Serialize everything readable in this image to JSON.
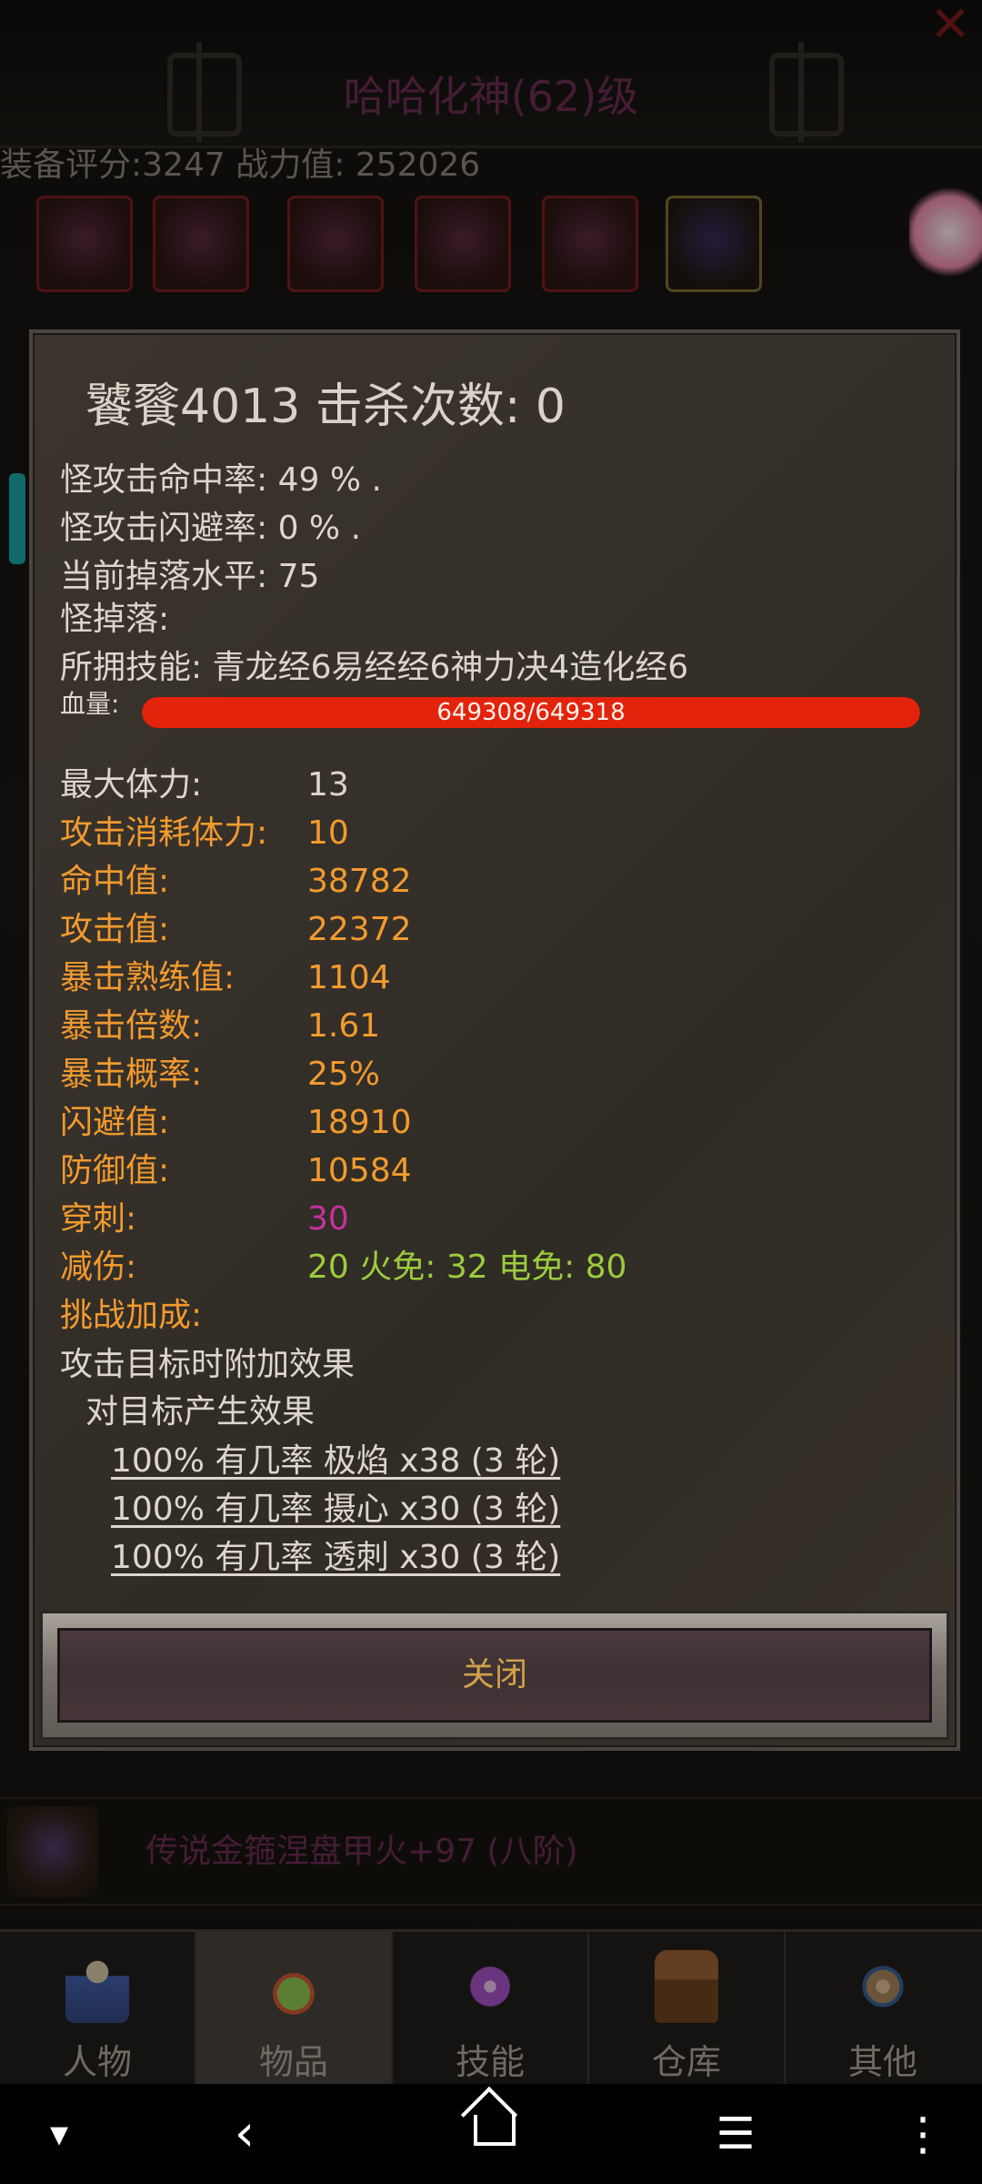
{
  "background": {
    "title": "哈哈化神(62)级",
    "stats_text": "装备评分:3247 战力值: 252026",
    "legend_item": "传说金箍涅盘甲火+97 (八阶)"
  },
  "dialog": {
    "title": "饕餮4013  击杀次数:  0",
    "lines": [
      "怪攻击命中率:  49 % .",
      "怪攻击闪避率:  0 % .",
      "当前掉落水平:  75",
      "怪掉落:",
      "所拥技能:  青龙经6易经经6神力决4造化经6"
    ],
    "hp": {
      "label": "血量:",
      "text": "649308/649318",
      "current": 649308,
      "max": 649318
    },
    "stats": [
      {
        "label": "最大体力:",
        "value": "13",
        "color": "white"
      },
      {
        "label": "攻击消耗体力:",
        "value": "10",
        "color": "orange"
      },
      {
        "label": "命中值:",
        "value": "38782",
        "color": "orange"
      },
      {
        "label": "攻击值:",
        "value": "22372",
        "color": "orange"
      },
      {
        "label": "暴击熟练值:",
        "value": "1104",
        "color": "orange"
      },
      {
        "label": "暴击倍数:",
        "value": "1.61",
        "color": "orange"
      },
      {
        "label": "暴击概率:",
        "value": "25%",
        "color": "orange"
      },
      {
        "label": "闪避值:",
        "value": "18910",
        "color": "orange"
      },
      {
        "label": "防御值:",
        "value": "10584",
        "color": "orange"
      },
      {
        "label": "穿刺:",
        "value": "30",
        "color": "orange",
        "value_color": "magenta"
      },
      {
        "label": "减伤:",
        "value": "20 火免:  32 电免:  80",
        "color": "orange",
        "value_color": "green"
      },
      {
        "label": "挑战加成:",
        "value": "",
        "color": "orange"
      }
    ],
    "effects_heading": "攻击目标时附加效果",
    "effects_subheading": "对目标产生效果",
    "effects": [
      "100% 有几率 极焰 x38 (3 轮)",
      "100% 有几率 摄心 x30 (3 轮)",
      "100% 有几率 透刺 x30 (3 轮)"
    ],
    "close_label": "关闭"
  },
  "tabs": [
    {
      "label": "人物",
      "icon": "character-icon"
    },
    {
      "label": "物品",
      "icon": "items-icon",
      "active": true
    },
    {
      "label": "技能",
      "icon": "skills-icon"
    },
    {
      "label": "仓库",
      "icon": "warehouse-icon"
    },
    {
      "label": "其他",
      "icon": "other-icon"
    }
  ],
  "colors": {
    "white": "#dcd6cc",
    "orange": "#f29a2e",
    "magenta": "#c8329c",
    "green": "#9ccc3d",
    "hp_fill": "#e3230c",
    "close_text": "#d0a24a"
  }
}
